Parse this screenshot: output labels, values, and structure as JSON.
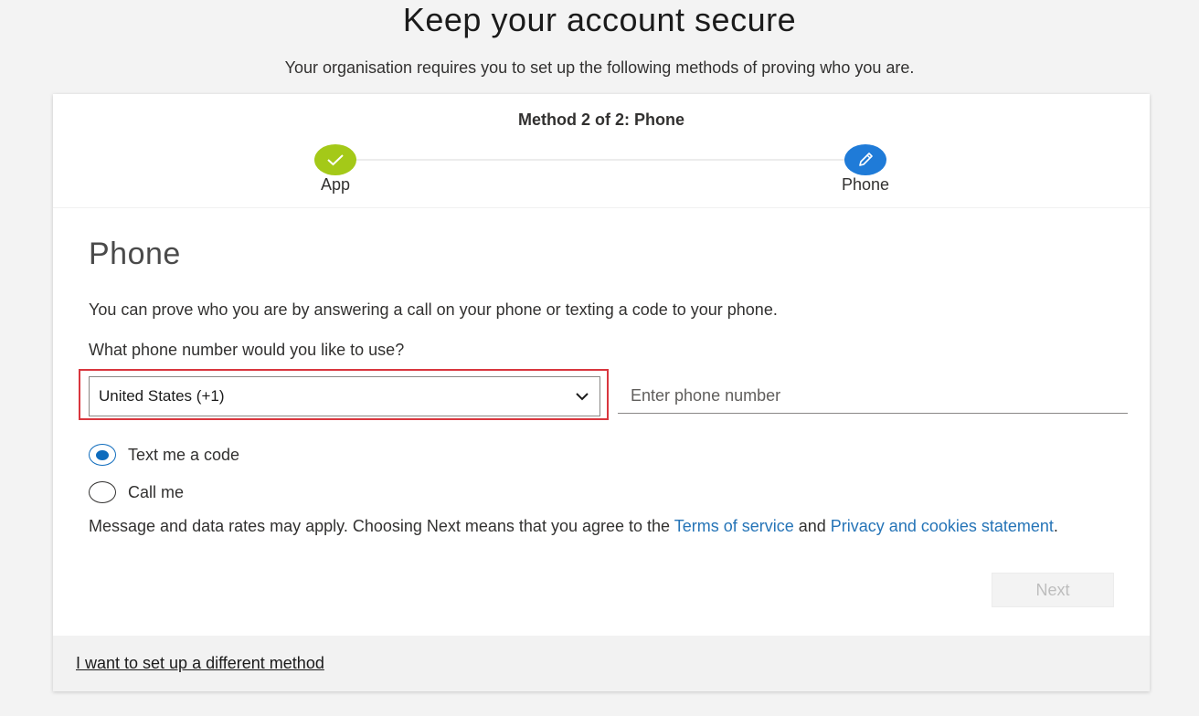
{
  "page": {
    "title": "Keep your account secure",
    "subtitle": "Your organisation requires you to set up the following methods of proving who you are."
  },
  "stepper": {
    "method_label": "Method 2 of 2: Phone",
    "steps": [
      {
        "label": "App",
        "status": "complete",
        "icon": "checkmark-icon",
        "color": "#a4c918"
      },
      {
        "label": "Phone",
        "status": "current",
        "icon": "pencil-icon",
        "color": "#1f7bd8"
      }
    ]
  },
  "form": {
    "heading": "Phone",
    "description": "You can prove who you are by answering a call on your phone or texting a code to your phone.",
    "question": "What phone number would you like to use?",
    "country_select": {
      "selected": "United States (+1)",
      "icon": "chevron-down-icon"
    },
    "phone_input": {
      "placeholder": "Enter phone number",
      "value": ""
    },
    "radio_options": [
      {
        "label": "Text me a code",
        "checked": true
      },
      {
        "label": "Call me",
        "checked": false
      }
    ],
    "disclaimer": {
      "text_before": "Message and data rates may apply. Choosing Next means that you agree to the ",
      "terms_link": "Terms of service",
      "text_between": " and ",
      "privacy_link": "Privacy and cookies statement",
      "text_after": "."
    },
    "next_label": "Next"
  },
  "footer": {
    "link_label": "I want to set up a different method"
  },
  "colors": {
    "accent": "#0f6cbd",
    "link": "#2574b7",
    "highlight_border": "#d9363e"
  }
}
